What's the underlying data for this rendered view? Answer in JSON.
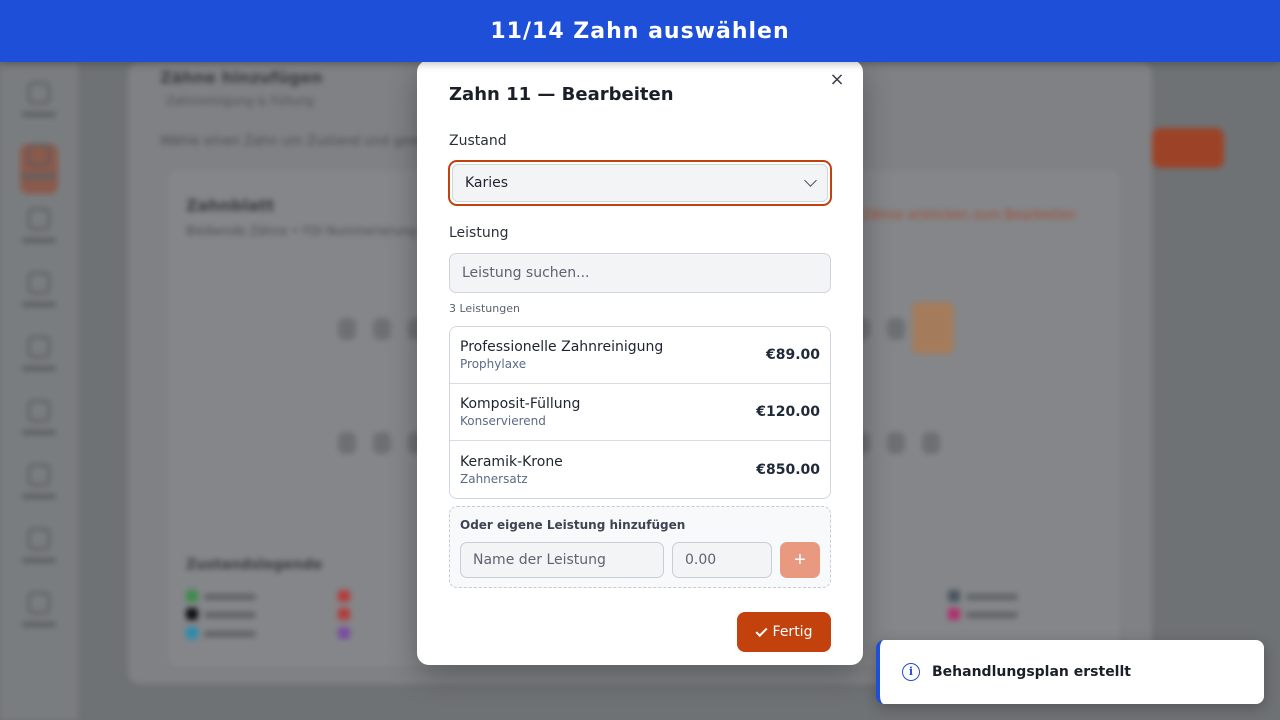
{
  "banner": {
    "text": "11/14 Zahn auswählen"
  },
  "background": {
    "title": "Zähne hinzufügen",
    "breadcrumb": "Zahnreinigung & Füllung",
    "hint": "Wähle einen Zahn um Zustand und gewünschte Leistung festzulegen",
    "card_title": "Zahnblatt",
    "card_subtitle": "Bleibende Zähne • FDI Nummerierung",
    "card_link": "Zähne anklicken zum Bearbeiten",
    "legend_title": "Zustandslegende"
  },
  "modal": {
    "title": "Zahn 11 — Bearbeiten",
    "close_icon": "×",
    "condition_label": "Zustand",
    "condition_value": "Karies",
    "service_label": "Leistung",
    "search_placeholder": "Leistung suchen...",
    "count_text": "3 Leistungen",
    "services": [
      {
        "name": "Professionelle Zahnreinigung",
        "category": "Prophylaxe",
        "price": "€89.00"
      },
      {
        "name": "Komposit-Füllung",
        "category": "Konservierend",
        "price": "€120.00"
      },
      {
        "name": "Keramik-Krone",
        "category": "Zahnersatz",
        "price": "€850.00"
      }
    ],
    "custom": {
      "label": "Oder eigene Leistung hinzufügen",
      "name_placeholder": "Name der Leistung",
      "price_placeholder": "0.00",
      "add_icon": "+"
    },
    "done_label": "Fertig"
  },
  "toast": {
    "text": "Behandlungsplan erstellt",
    "icon": "i"
  },
  "colors": {
    "accent": "#c2410c",
    "banner": "#1d4fd8"
  }
}
